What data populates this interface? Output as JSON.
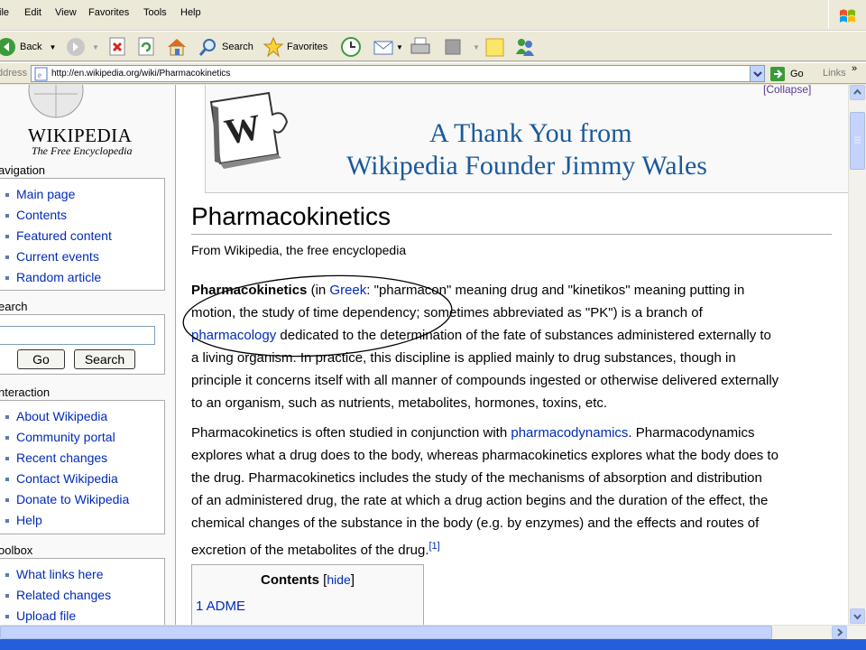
{
  "menu": [
    "ile",
    "Edit",
    "View",
    "Favorites",
    "Tools",
    "Help"
  ],
  "toolbar": {
    "back_label": "Back",
    "search_label": "Search",
    "favorites_label": "Favorites"
  },
  "address": {
    "label": "ddress",
    "url": "http://en.wikipedia.org/wiki/Pharmacokinetics",
    "go_label": "Go",
    "links_label": "Links"
  },
  "logo": {
    "name": "WIKIPEDIA",
    "tagline": "The Free Encyclopedia"
  },
  "sidebar": {
    "navigation_heading": "avigation",
    "navigation": [
      "Main page",
      "Contents",
      "Featured content",
      "Current events",
      "Random article"
    ],
    "search_heading": "earch",
    "search_value": "",
    "go_button": "Go",
    "search_button": "Search",
    "interaction_heading": "nteraction",
    "interaction": [
      "About Wikipedia",
      "Community portal",
      "Recent changes",
      "Contact Wikipedia",
      "Donate to Wikipedia",
      "Help"
    ],
    "toolbox_heading": "oolbox",
    "toolbox": [
      "What links here",
      "Related changes",
      "Upload file"
    ]
  },
  "banner": {
    "collapse": "[Collapse]",
    "line1": "A Thank You from",
    "line2": "Wikipedia Founder Jimmy Wales"
  },
  "article": {
    "title": "Pharmacokinetics",
    "from": "From Wikipedia, the free encyclopedia",
    "p1": {
      "bold": "Pharmacokinetics",
      "t1": " (in ",
      "link_greek": "Greek",
      "t2": ": \"pharmacon\" meaning drug and \"kinetikos\" meaning putting in",
      "line2": "motion, the study of time dependency; sometimes abbreviated as \"PK\") is a branch of",
      "link_pharmacology": "pharmacology",
      "t3": " dedicated to the determination of the fate of substances administered externally to",
      "line4": "a living organism. In practice, this discipline is applied mainly to drug substances, though in",
      "line5": "principle it concerns itself with all manner of compounds ingested or otherwise delivered externally",
      "line6": "to an organism, such as nutrients, metabolites, hormones, toxins, etc."
    },
    "p2": {
      "t1": "Pharmacokinetics is often studied in conjunction with ",
      "link_pd": "pharmacodynamics",
      "t2": ". Pharmacodynamics",
      "line2": "explores what a drug does to the body, whereas pharmacokinetics explores what the body does to",
      "line3": "the drug. Pharmacokinetics includes the study of the mechanisms of absorption and distribution",
      "line4": "of an administered drug, the rate at which a drug action begins and the duration of the effect, the",
      "line5": "chemical changes of the substance in the body (e.g. by enzymes) and the effects and routes of",
      "line6": "excretion of the metabolites of the drug.",
      "ref": "[1]"
    },
    "toc": {
      "title": "Contents",
      "hide": "hide",
      "item1": "1 ADME"
    }
  },
  "colors": {
    "link": "#002bb8",
    "banner_text": "#1a5a9a",
    "annotation": "#000000"
  }
}
